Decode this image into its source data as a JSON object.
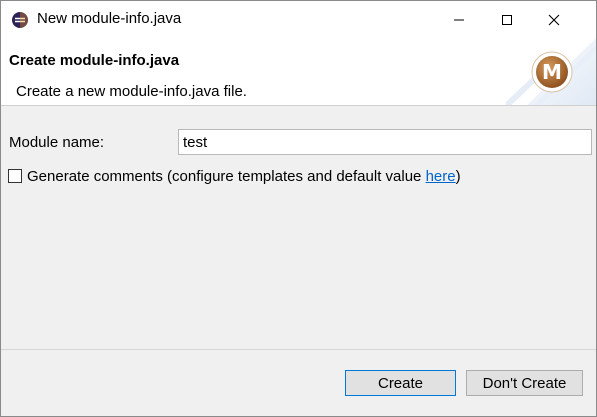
{
  "window": {
    "title": "New module-info.java",
    "app_icon": "eclipse-icon",
    "controls": [
      "minimize-icon",
      "maximize-icon",
      "close-icon"
    ]
  },
  "header": {
    "title": "Create module-info.java",
    "description": "Create a new module-info.java file.",
    "badge_letter": "M"
  },
  "form": {
    "module_name_label": "Module name:",
    "module_name_value": "test",
    "generate_comments_checked": false,
    "generate_comments_text": "Generate comments (configure templates and default value ",
    "generate_comments_link": "here",
    "generate_comments_suffix": ")"
  },
  "buttons": {
    "create": "Create",
    "dont_create": "Don't Create"
  },
  "colors": {
    "link": "#0066cc",
    "default_button_border": "#0078d7",
    "badge": "#a0622a"
  }
}
